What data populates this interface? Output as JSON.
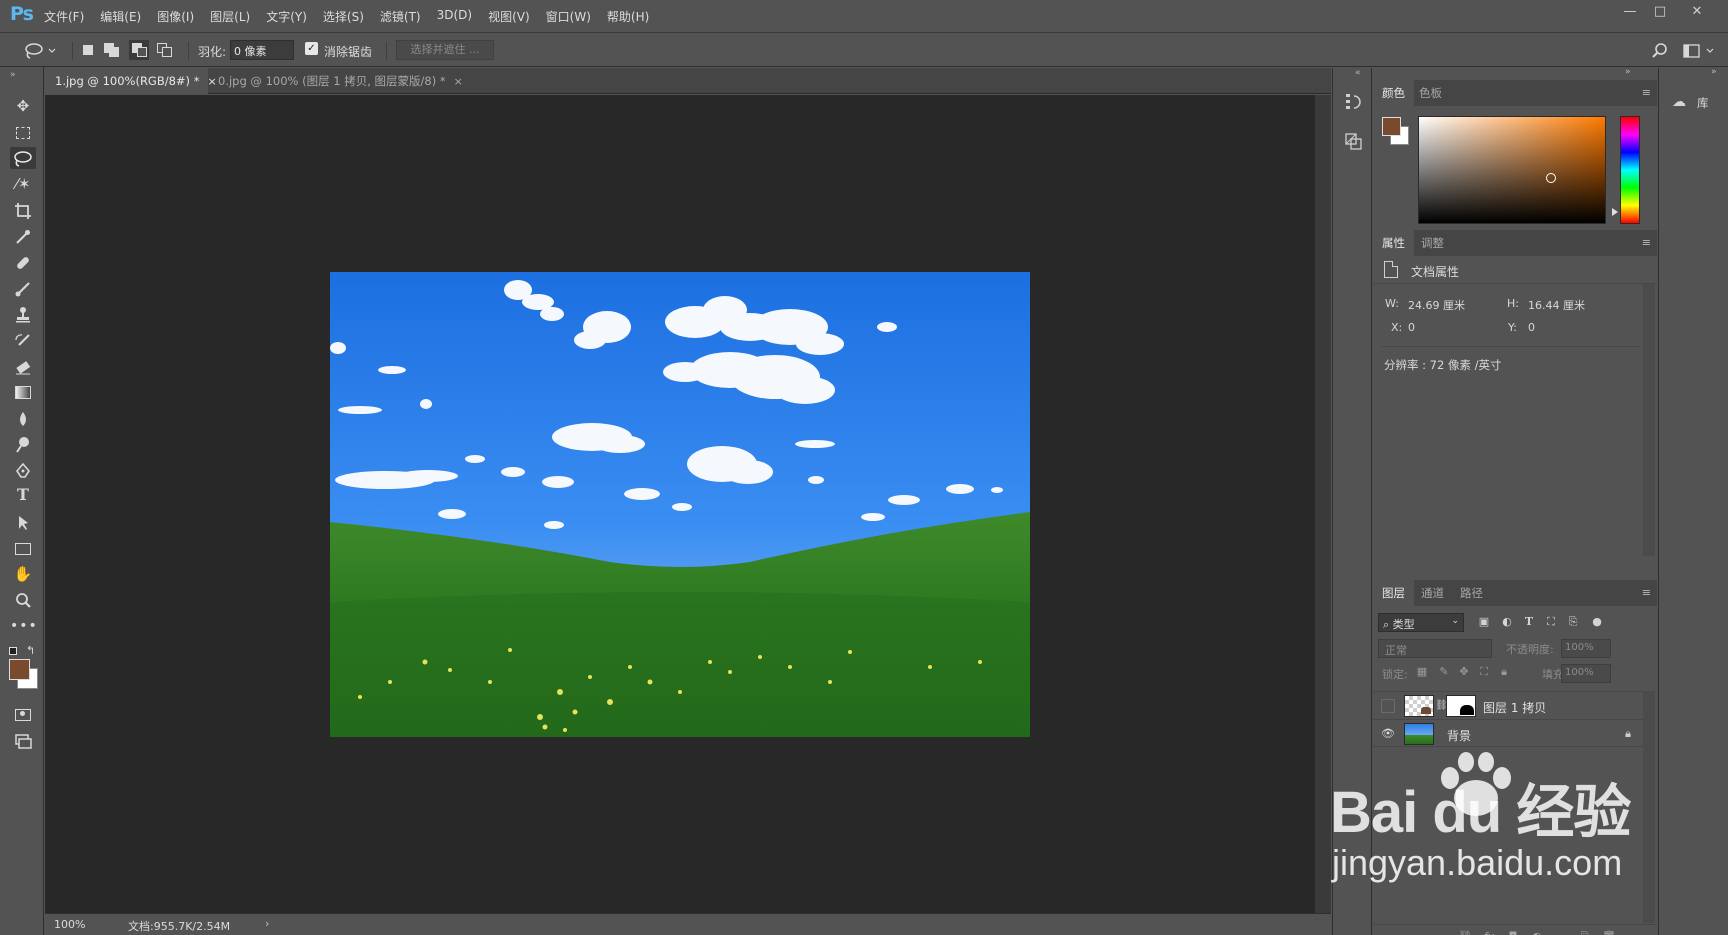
{
  "app": {
    "logo": "Ps",
    "menu": [
      "文件(F)",
      "编辑(E)",
      "图像(I)",
      "图层(L)",
      "文字(Y)",
      "选择(S)",
      "滤镜(T)",
      "3D(D)",
      "视图(V)",
      "窗口(W)",
      "帮助(H)"
    ],
    "window_buttons": [
      "—",
      "□",
      "✕"
    ]
  },
  "options": {
    "feather_label": "羽化:",
    "feather_value": "0 像素",
    "antialias_label": "消除锯齿",
    "antialias_checked": true,
    "select_mask_label": "选择并遮住 ..."
  },
  "tools": [
    "move-tool",
    "marquee-tool",
    "lasso-tool",
    "quick-selection-tool",
    "crop-tool",
    "eyedropper-tool",
    "healing-brush-tool",
    "brush-tool",
    "clone-stamp-tool",
    "history-brush-tool",
    "eraser-tool",
    "gradient-tool",
    "blur-tool",
    "dodge-tool",
    "pen-tool",
    "type-tool",
    "path-selection-tool",
    "rectangle-tool",
    "hand-tool",
    "zoom-tool",
    "more-tools"
  ],
  "documents": {
    "tabs": [
      {
        "label": "1.jpg @ 100%(RGB/8#) *",
        "active": true
      },
      {
        "label": "0.jpg @ 100% (图层 1 拷贝, 图层蒙版/8) *",
        "active": false
      }
    ],
    "tab_close": "×",
    "zoom": "100%",
    "doc_size": "文档:955.7K/2.54M",
    "status_arrow": "›"
  },
  "colors": {
    "foreground": "#7a4a2e",
    "background": "#ffffff",
    "picker_hue": "#ff7a00"
  },
  "color_panel": {
    "tabs": [
      "颜色",
      "色板"
    ]
  },
  "properties_panel": {
    "tabs": [
      "属性",
      "调整"
    ],
    "header": "文档属性",
    "w_label": "W:",
    "w_value": "24.69 厘米",
    "h_label": "H:",
    "h_value": "16.44 厘米",
    "x_label": "X:",
    "x_value": "0",
    "y_label": "Y:",
    "y_value": "0",
    "resolution": "分辨率 : 72 像素 /英寸"
  },
  "layers_panel": {
    "tabs": [
      "图层",
      "通道",
      "路径"
    ],
    "filter": "类型",
    "blend_mode": "正常",
    "opacity_label": "不透明度:",
    "opacity_value": "100%",
    "lock_label": "锁定:",
    "fill_label": "填充:",
    "fill_value": "100%",
    "layers": [
      {
        "name": "图层 1 拷贝",
        "visible": false,
        "has_mask": true,
        "locked": false
      },
      {
        "name": "背景",
        "visible": true,
        "has_mask": false,
        "locked": true
      }
    ]
  },
  "library": {
    "label": "库"
  },
  "watermark": {
    "brand": "Bai du 经验",
    "url": "jingyan.baidu.com"
  }
}
